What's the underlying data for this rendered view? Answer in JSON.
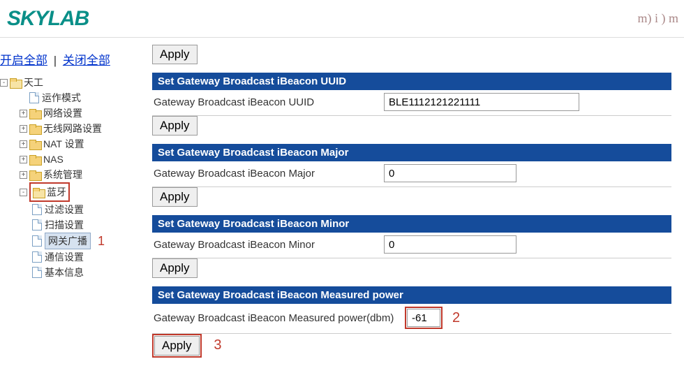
{
  "header": {
    "logo_text": "SKYLAB",
    "mim": "m) i ) m"
  },
  "sidebar": {
    "open_all": "开启全部",
    "close_all": "关闭全部",
    "root": "天工",
    "items": [
      {
        "label": "运作模式",
        "icon": "page",
        "expand": ""
      },
      {
        "label": "网络设置",
        "icon": "folder",
        "expand": "+"
      },
      {
        "label": "无线网路设置",
        "icon": "folder",
        "expand": "+"
      },
      {
        "label": "NAT 设置",
        "icon": "folder",
        "expand": "+"
      },
      {
        "label": "NAS",
        "icon": "folder",
        "expand": "+"
      },
      {
        "label": "系统管理",
        "icon": "folder",
        "expand": "+"
      },
      {
        "label": "蓝牙",
        "icon": "folder-open",
        "expand": "-"
      }
    ],
    "bluetooth_children": [
      {
        "label": "过滤设置"
      },
      {
        "label": "扫描设置"
      },
      {
        "label": "网关广播",
        "selected": true
      },
      {
        "label": "通信设置"
      },
      {
        "label": "基本信息"
      }
    ]
  },
  "main": {
    "apply_label": "Apply",
    "sections": {
      "uuid": {
        "header": "Set Gateway Broadcast iBeacon UUID",
        "label": "Gateway Broadcast iBeacon UUID",
        "value": "BLE1112121221111"
      },
      "major": {
        "header": "Set Gateway Broadcast iBeacon Major",
        "label": "Gateway Broadcast iBeacon Major",
        "value": "0"
      },
      "minor": {
        "header": "Set Gateway Broadcast iBeacon Minor",
        "label": "Gateway Broadcast iBeacon Minor",
        "value": "0"
      },
      "mp": {
        "header": "Set Gateway Broadcast iBeacon Measured power",
        "label": "Gateway Broadcast iBeacon Measured power(dbm)",
        "value": "-61"
      }
    }
  },
  "annotations": {
    "one": "1",
    "two": "2",
    "three": "3"
  }
}
